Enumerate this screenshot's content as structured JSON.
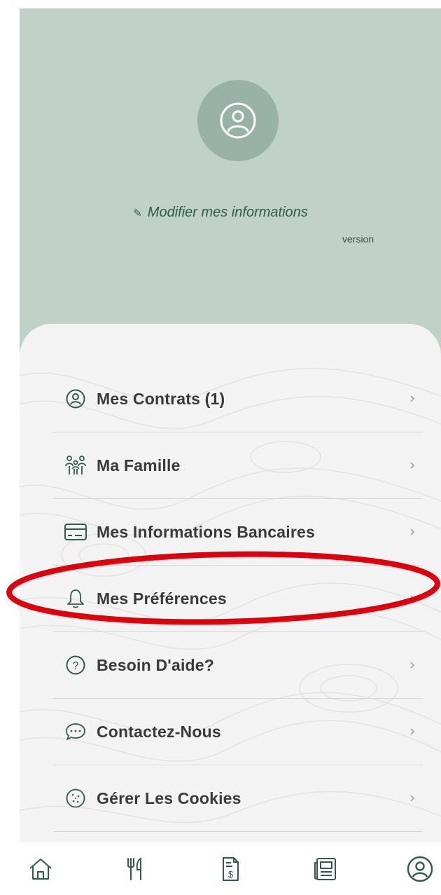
{
  "profile": {
    "edit_label": "Modifier mes informations",
    "version_label": "version"
  },
  "menu": {
    "items": [
      {
        "label": "Mes Contrats (1)",
        "icon": "user-circle-icon"
      },
      {
        "label": "Ma Famille",
        "icon": "family-icon"
      },
      {
        "label": "Mes Informations Bancaires",
        "icon": "credit-card-icon"
      },
      {
        "label": "Mes Préférences",
        "icon": "bell-icon"
      },
      {
        "label": "Besoin D'aide?",
        "icon": "help-circle-icon"
      },
      {
        "label": "Contactez-Nous",
        "icon": "chat-bubble-icon"
      },
      {
        "label": "Gérer Les Cookies",
        "icon": "cookie-icon"
      }
    ]
  },
  "bottom_nav": {
    "items": [
      {
        "icon": "home-icon"
      },
      {
        "icon": "restaurant-icon"
      },
      {
        "icon": "invoice-icon"
      },
      {
        "icon": "news-icon"
      },
      {
        "icon": "profile-icon",
        "active": true
      }
    ]
  },
  "colors": {
    "header_bg": "#c0d2c8",
    "accent": "#2f5c4a",
    "highlight": "#e0000b"
  }
}
